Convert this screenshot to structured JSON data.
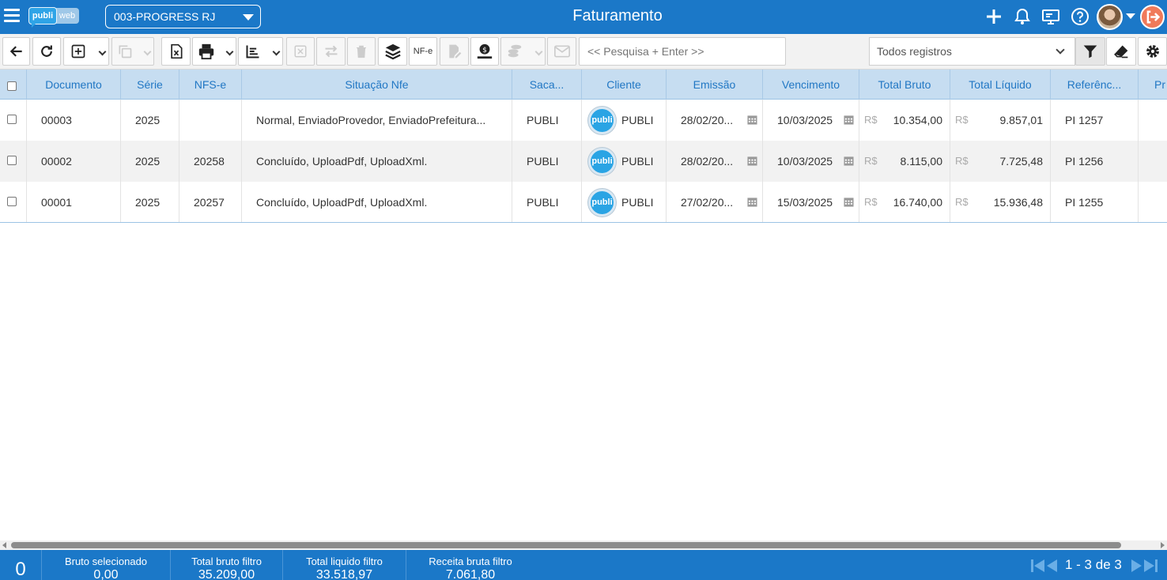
{
  "app": {
    "logo_left": "publi",
    "logo_right": "web",
    "company": "003-PROGRESS RJ",
    "title": "Faturamento"
  },
  "toolbar": {
    "nfe_label": "NF-e",
    "search_placeholder": "<< Pesquisa + Enter >>",
    "filter_value": "Todos registros"
  },
  "colors": {
    "primary": "#1b78c8",
    "header_bg": "#c6ddf1",
    "header_text": "#2177c4",
    "logout": "#f07a5a"
  },
  "grid": {
    "columns": [
      "Documento",
      "Série",
      "NFS-e",
      "Situação Nfe",
      "Saca...",
      "Cliente",
      "Emissão",
      "Vencimento",
      "Total Bruto",
      "Total Líquido",
      "Referênc...",
      "Pr"
    ],
    "currency_symbol": "R$",
    "rows": [
      {
        "documento": "00003",
        "serie": "2025",
        "nfse": "",
        "situacao": "Normal, EnviadoProvedor, EnviadoPrefeitura...",
        "sacado": "PUBLI",
        "cliente_logo": "publi",
        "cliente": "PUBLI",
        "emissao": "28/02/20...",
        "vencimento": "10/03/2025",
        "total_bruto": "10.354,00",
        "total_liquido": "9.857,01",
        "referencia": "PI 1257"
      },
      {
        "documento": "00002",
        "serie": "2025",
        "nfse": "20258",
        "situacao": "Concluído, UploadPdf, UploadXml.",
        "sacado": "PUBLI",
        "cliente_logo": "publi",
        "cliente": "PUBLI",
        "emissao": "28/02/20...",
        "vencimento": "10/03/2025",
        "total_bruto": "8.115,00",
        "total_liquido": "7.725,48",
        "referencia": "PI 1256"
      },
      {
        "documento": "00001",
        "serie": "2025",
        "nfse": "20257",
        "situacao": "Concluído, UploadPdf, UploadXml.",
        "sacado": "PUBLI",
        "cliente_logo": "publi",
        "cliente": "PUBLI",
        "emissao": "27/02/20...",
        "vencimento": "15/03/2025",
        "total_bruto": "16.740,00",
        "total_liquido": "15.936,48",
        "referencia": "PI 1255"
      }
    ]
  },
  "footer": {
    "selected_count": "0",
    "bruto_selecionado_label": "Bruto selecionado",
    "bruto_selecionado_value": "0,00",
    "total_bruto_filtro_label": "Total bruto filtro",
    "total_bruto_filtro_value": "35.209,00",
    "total_liquido_filtro_label": "Total liquido filtro",
    "total_liquido_filtro_value": "33.518,97",
    "receita_bruta_filtro_label": "Receita bruta filtro",
    "receita_bruta_filtro_value": "7.061,80",
    "pager_text": "1 - 3 de 3"
  }
}
